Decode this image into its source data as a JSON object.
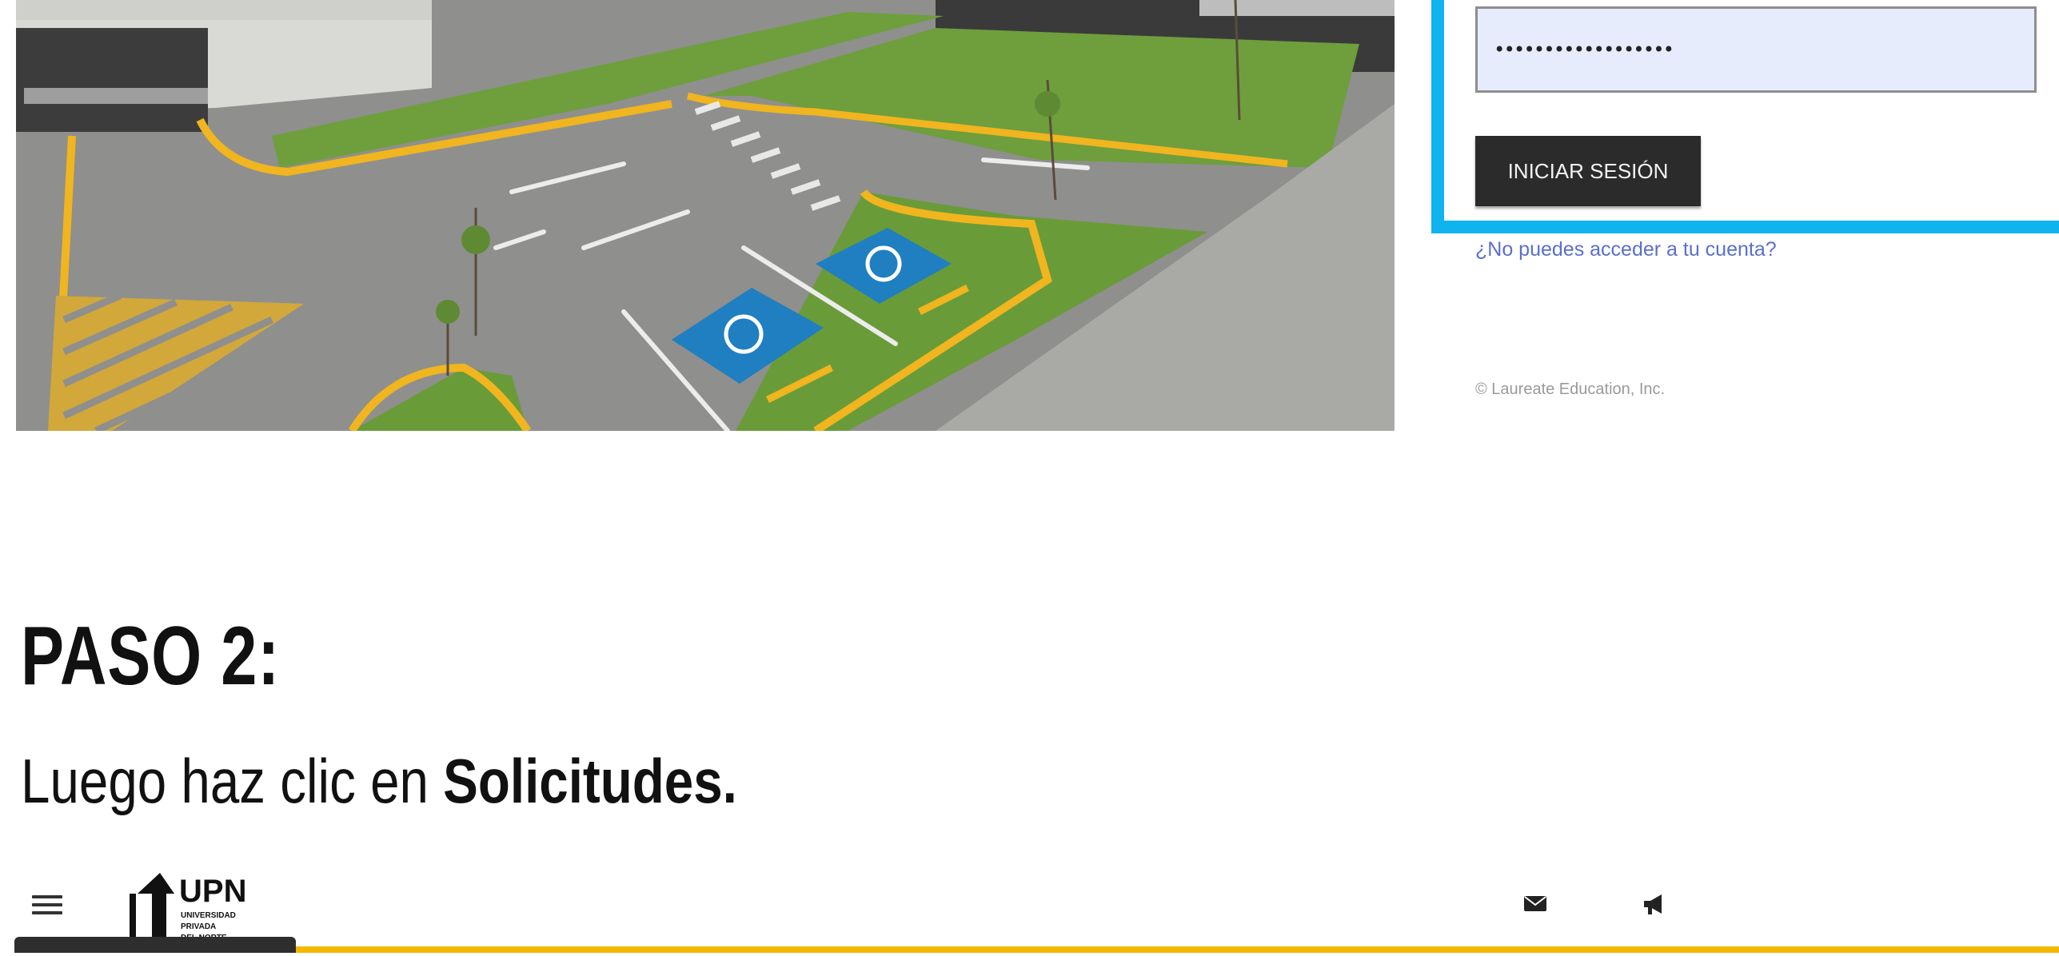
{
  "login": {
    "password_value": "••••••••••••••••••",
    "login_button_label": "INICIAR SESIÓN",
    "forgot_link": "¿No puedes acceder a tu cuenta?",
    "copyright": "© Laureate Education, Inc."
  },
  "step": {
    "title": "PASO 2:",
    "instruction_prefix": "Luego haz clic en ",
    "instruction_bold": "Solicitudes."
  },
  "app_header": {
    "logo_text": "UPN",
    "logo_subtext": [
      "UNIVERSIDAD",
      "PRIVADA",
      "DEL NORTE"
    ],
    "icons": [
      "menu-icon",
      "mail-icon",
      "megaphone-icon"
    ]
  },
  "colors": {
    "login_frame": "#0eb3f0",
    "accent_yellow": "#f5b800",
    "button_dark": "#2b2b2b",
    "link_blue": "#5a6fcc"
  }
}
